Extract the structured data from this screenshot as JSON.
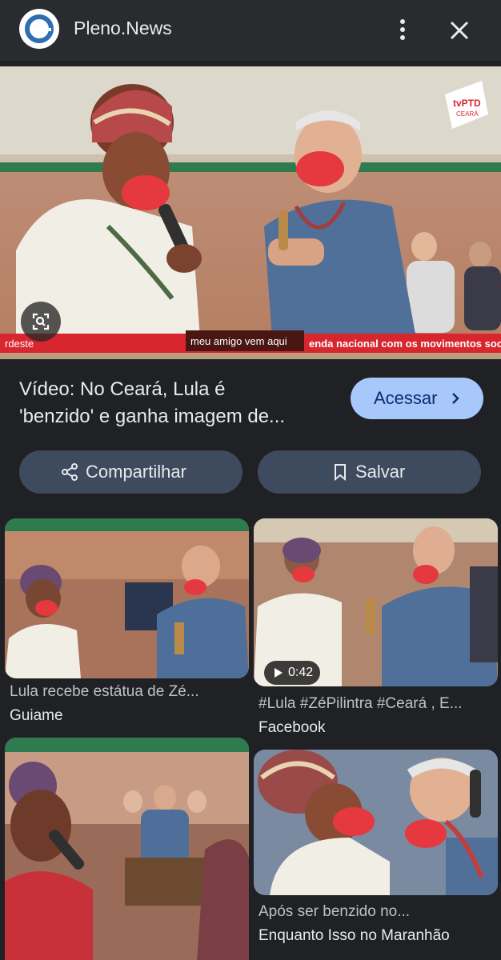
{
  "header": {
    "site_name": "Pleno.News"
  },
  "hero": {
    "caption": "meu amigo vem aqui",
    "ticker_left": "rdeste",
    "ticker_right": "enda nacional com os movimentos sociais",
    "watermark_top": "tvPTD",
    "watermark_bottom": "CEARÁ"
  },
  "result": {
    "title_line1": "Vídeo: No Ceará, Lula é",
    "title_line2": "'benzido' e ganha imagem de...",
    "visit_label": "Acessar"
  },
  "actions": {
    "share_label": "Compartilhar",
    "save_label": "Salvar"
  },
  "related": [
    {
      "title": "Lula recebe estátua de Zé...",
      "source": "Guiame"
    },
    {
      "title": "#Lula #ZéPilintra #Ceará , E...",
      "source": "Facebook",
      "duration": "0:42"
    },
    {
      "title": "",
      "source": ""
    },
    {
      "title": "Após ser benzido no...",
      "source": "Enquanto Isso no Maranhão"
    }
  ],
  "colors": {
    "background": "#202124",
    "topbar": "#2a2b2e",
    "accent": "#a8c7fa",
    "pill": "#3e4a5e"
  }
}
